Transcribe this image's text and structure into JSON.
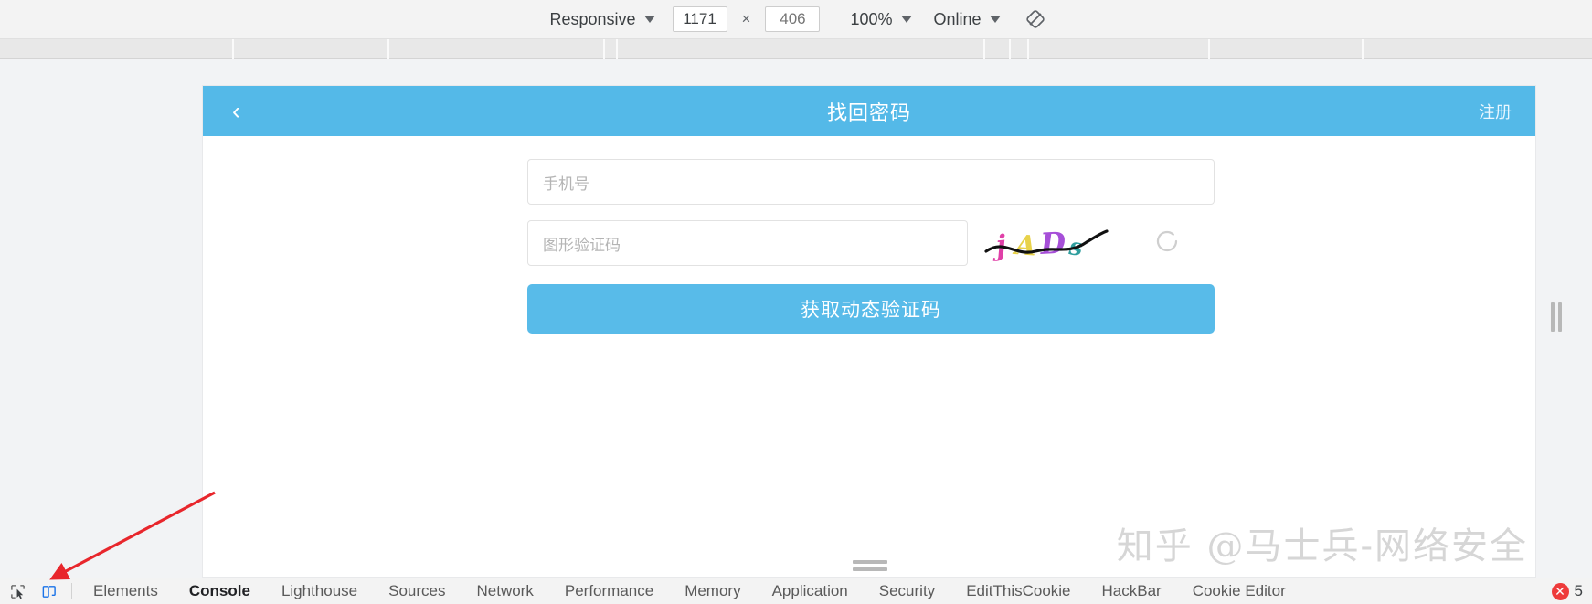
{
  "device_toolbar": {
    "device_preset": "Responsive",
    "width_value": "1171",
    "height_value": "406",
    "height_placeholder": "406",
    "zoom": "100%",
    "throttling": "Online",
    "multiply_symbol": "×",
    "rotate_icon": "rotate-icon"
  },
  "page": {
    "header": {
      "back_icon": "‹",
      "title": "找回密码",
      "register_link": "注册",
      "background_color": "#54b9e8"
    },
    "form": {
      "phone_placeholder": "手机号",
      "captcha_placeholder": "图形验证码",
      "captcha_text": "jADs",
      "captcha_colors": [
        "#e040a8",
        "#e8d24a",
        "#a64fd8",
        "#2f9e9e"
      ],
      "refresh_icon": "refresh-icon",
      "submit_label": "获取动态验证码",
      "submit_color": "#58bbe9"
    },
    "watermark": "知乎 @马士兵-网络安全"
  },
  "devtools": {
    "inspect_icon": "inspect-element-icon",
    "device_toolbar_icon": "device-toolbar-icon",
    "tabs": [
      {
        "label": "Elements",
        "active": false
      },
      {
        "label": "Console",
        "active": true
      },
      {
        "label": "Lighthouse",
        "active": false
      },
      {
        "label": "Sources",
        "active": false
      },
      {
        "label": "Network",
        "active": false
      },
      {
        "label": "Performance",
        "active": false
      },
      {
        "label": "Memory",
        "active": false
      },
      {
        "label": "Application",
        "active": false
      },
      {
        "label": "Security",
        "active": false
      },
      {
        "label": "EditThisCookie",
        "active": false
      },
      {
        "label": "HackBar",
        "active": false
      },
      {
        "label": "Cookie Editor",
        "active": false
      }
    ],
    "error_icon": "error-badge-icon",
    "error_count": "5"
  }
}
